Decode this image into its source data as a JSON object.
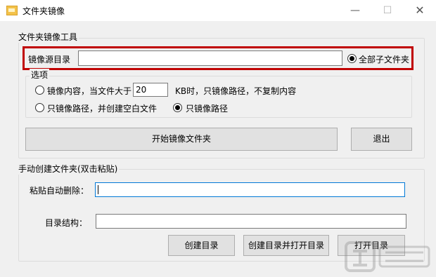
{
  "window": {
    "title": "文件夹镜像",
    "minimize": "—",
    "maximize": "☐",
    "close": "✕"
  },
  "mirror_group": {
    "title": "文件夹镜像工具",
    "source_label": "镜像源目录",
    "source_value": "",
    "all_subfolders_label": "全部子文件夹",
    "all_subfolders_checked": true,
    "options": {
      "title": "选项",
      "mirror_content_label": "镜像内容，当文件大于",
      "size_threshold": "20",
      "size_suffix": "KB时，只镜像路径，不复制内容",
      "mirror_content_checked": false,
      "path_blank_files_label": "只镜像路径，并创建空白文件",
      "path_blank_files_checked": false,
      "path_only_label": "只镜像路径",
      "path_only_checked": true
    },
    "start_button": "开始镜像文件夹",
    "exit_button": "退出"
  },
  "manual_group": {
    "title": "手动创建文件夹(双击粘贴)",
    "paste_label": "粘贴自动删除：",
    "paste_value": "",
    "structure_label": "目录结构：",
    "structure_value": "",
    "create_button": "创建目录",
    "create_open_button": "创建目录并打开目录",
    "open_button": "打开目录"
  }
}
